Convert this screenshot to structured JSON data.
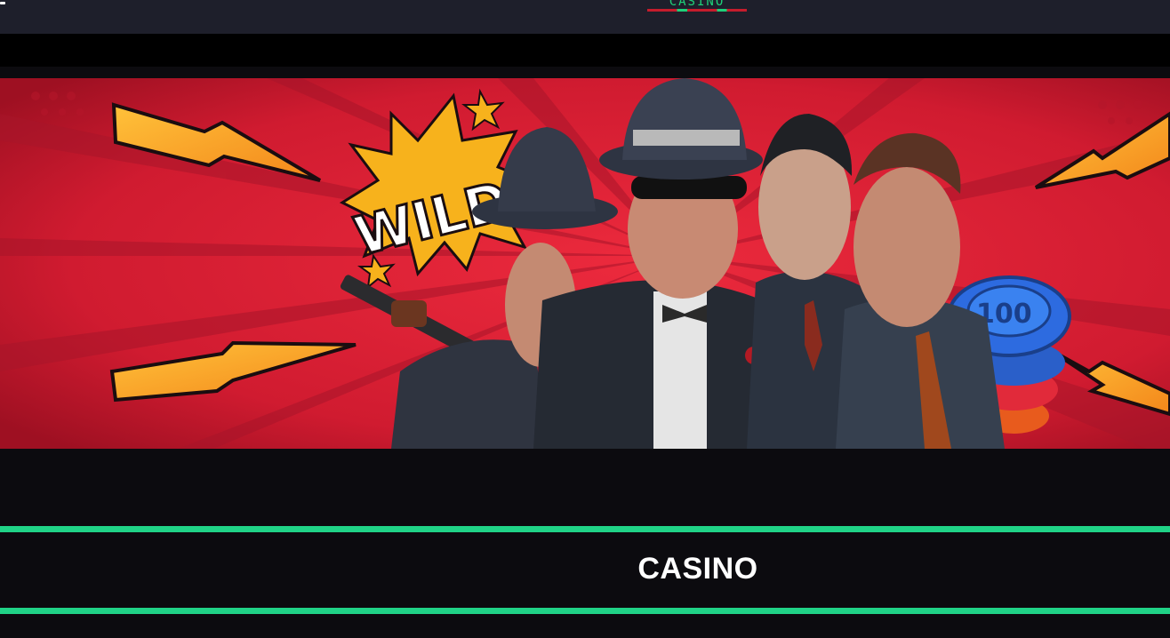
{
  "header": {
    "logo_text": "CASINO",
    "colors": {
      "background": "#1e1f2b",
      "logo_green": "#1fd17a",
      "logo_red": "#c61c2c"
    }
  },
  "banner": {
    "wild_text": "WILD!!",
    "chip_value": "100",
    "colors": {
      "background": "#d81c31",
      "bolt": "#f7a21b"
    }
  },
  "section": {
    "title": "CASINO",
    "colors": {
      "rule": "#20d387",
      "background": "#0c0b0f"
    }
  }
}
